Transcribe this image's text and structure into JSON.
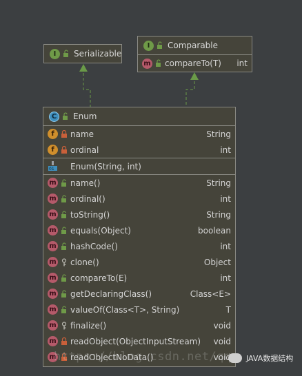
{
  "serializable": {
    "kind_icon": "interface-icon",
    "name": "Serializable"
  },
  "comparable": {
    "kind_icon": "interface-icon",
    "name": "Comparable",
    "methods": [
      {
        "name": "compareTo(T)",
        "type": "int"
      }
    ]
  },
  "enum_class": {
    "kind_icon": "class-icon",
    "name": "Enum",
    "fields": [
      {
        "name": "name",
        "type": "String",
        "visibility": "private"
      },
      {
        "name": "ordinal",
        "type": "int",
        "visibility": "private"
      }
    ],
    "constructors": [
      {
        "name": "Enum(String, int)",
        "type": ""
      }
    ],
    "methods": [
      {
        "name": "name()",
        "type": "String",
        "visibility": "public"
      },
      {
        "name": "ordinal()",
        "type": "int",
        "visibility": "public"
      },
      {
        "name": "toString()",
        "type": "String",
        "visibility": "public"
      },
      {
        "name": "equals(Object)",
        "type": "boolean",
        "visibility": "public"
      },
      {
        "name": "hashCode()",
        "type": "int",
        "visibility": "public"
      },
      {
        "name": "clone()",
        "type": "Object",
        "visibility": "protected"
      },
      {
        "name": "compareTo(E)",
        "type": "int",
        "visibility": "public"
      },
      {
        "name": "getDeclaringClass()",
        "type": "Class<E>",
        "visibility": "public"
      },
      {
        "name": "valueOf(Class<T>, String)",
        "type": "T",
        "visibility": "public"
      },
      {
        "name": "finalize()",
        "type": "void",
        "visibility": "protected"
      },
      {
        "name": "readObject(ObjectInputStream)",
        "type": "void",
        "visibility": "private"
      },
      {
        "name": "readObjectNoData()",
        "type": "void",
        "visibility": "private"
      }
    ]
  },
  "watermark": {
    "url": "https://blog.csdn.net/qq",
    "brand": "JAVA数据结构"
  },
  "colors": {
    "background": "#3c3f41",
    "box": "#45443a",
    "arrow": "#6a9a48",
    "interface": "#6f9a48",
    "class": "#3f8fbd",
    "method": "#b55a6a",
    "field": "#d08f2c"
  }
}
